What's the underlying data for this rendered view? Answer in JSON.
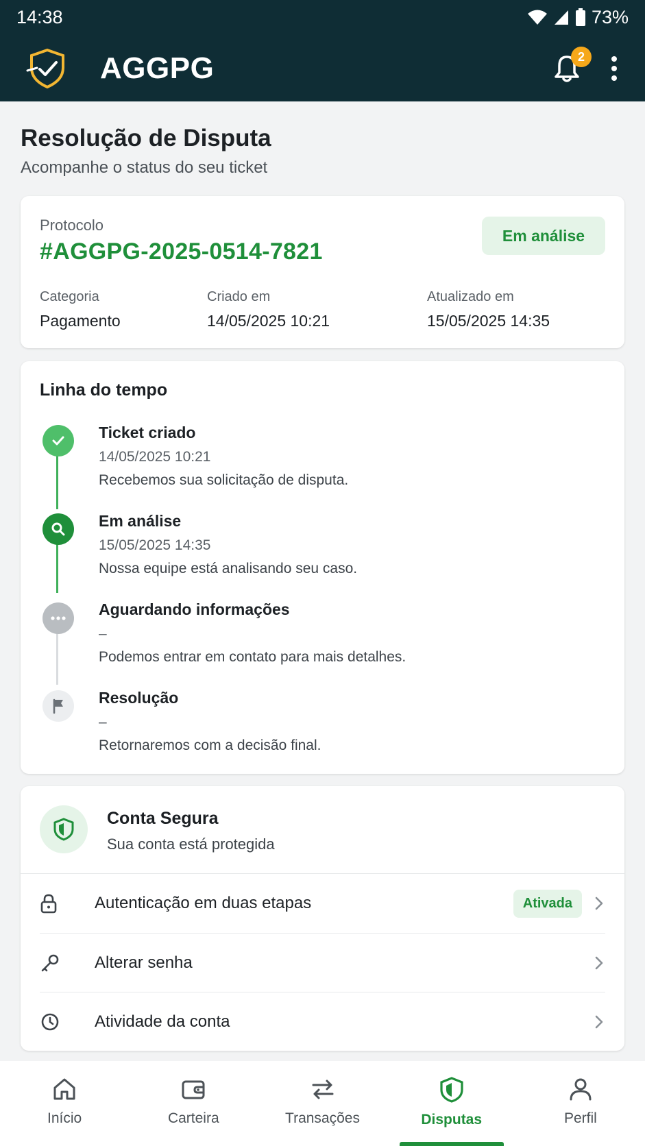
{
  "status_bar": {
    "time": "14:38",
    "battery": "73%",
    "icons": [
      "wifi-icon",
      "signal-icon",
      "battery-icon"
    ]
  },
  "app_bar": {
    "title": "AGGPG",
    "notification_count": "2",
    "icons": [
      "shield-logo-icon",
      "bell-icon",
      "more-vert-icon"
    ]
  },
  "page": {
    "title": "Resolução de Disputa",
    "subtitle": "Acompanhe o status do seu ticket"
  },
  "protocol": {
    "label": "Protocolo",
    "number": "#AGGPG-2025-0514-7821",
    "status": "Em análise",
    "meta": [
      {
        "label": "Categoria",
        "value": "Pagamento"
      },
      {
        "label": "Criado em",
        "value": "14/05/2025 10:21"
      },
      {
        "label": "Atualizado em",
        "value": "15/05/2025 14:35"
      }
    ]
  },
  "timeline": {
    "title": "Linha do tempo",
    "steps": [
      {
        "title": "Ticket criado",
        "date": "14/05/2025 10:21",
        "desc": "Recebemos sua solicitação de disputa.",
        "state": "done",
        "icon": "check-icon"
      },
      {
        "title": "Em análise",
        "date": "15/05/2025 14:35",
        "desc": "Nossa equipe está analisando seu caso.",
        "state": "current",
        "icon": "search-icon"
      },
      {
        "title": "Aguardando informações",
        "date": "–",
        "desc": "Podemos entrar em contato para mais detalhes.",
        "state": "pending",
        "icon": "more-horiz-icon"
      },
      {
        "title": "Resolução",
        "date": "–",
        "desc": "Retornaremos com a decisão final.",
        "state": "pending",
        "icon": "flag-icon"
      }
    ]
  },
  "security": {
    "title": "Conta Segura",
    "subtitle": "Sua conta está protegida",
    "items": [
      {
        "label": "Autenticação em duas etapas",
        "chip": "Ativada",
        "icon": "lock-icon"
      },
      {
        "label": "Alterar senha",
        "icon": "key-icon"
      },
      {
        "label": "Atividade da conta",
        "icon": "history-icon"
      }
    ]
  },
  "bottom_nav": {
    "items": [
      {
        "label": "Início",
        "icon": "home-icon"
      },
      {
        "label": "Carteira",
        "icon": "wallet-icon"
      },
      {
        "label": "Transações",
        "icon": "transfer-icon"
      },
      {
        "label": "Disputas",
        "icon": "shield-icon",
        "active": true
      },
      {
        "label": "Perfil",
        "icon": "person-icon"
      }
    ]
  },
  "colors": {
    "header_bg": "#0f2d35",
    "accent_green": "#1f8f3a",
    "light_green": "#e5f4e8",
    "badge_orange": "#f6a81a",
    "logo_gold": "#f2b632"
  }
}
